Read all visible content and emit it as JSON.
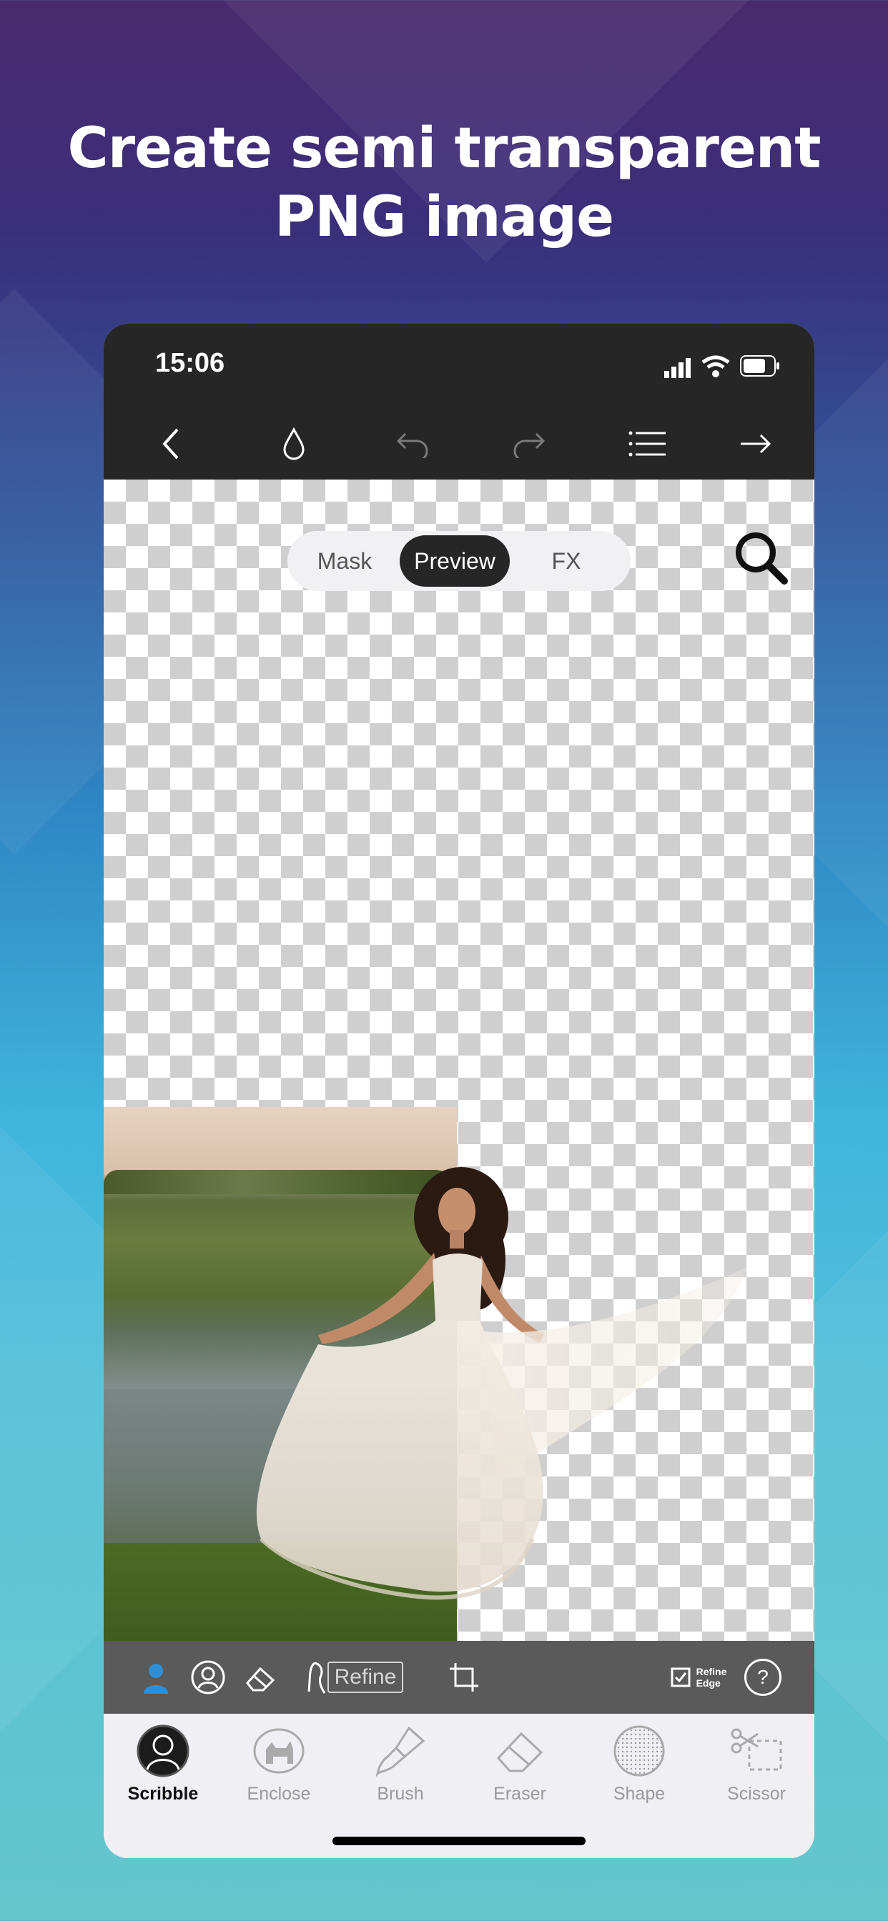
{
  "headline": {
    "line1": "Create semi transparent",
    "line2": "PNG image"
  },
  "status_bar": {
    "time": "15:06",
    "icons": [
      "cellular-signal-icon",
      "wifi-icon",
      "battery-icon"
    ]
  },
  "toolbar": {
    "icons": [
      "back-chevron-icon",
      "drop-icon",
      "undo-icon",
      "redo-icon",
      "menu-list-icon",
      "forward-arrow-icon"
    ]
  },
  "view_toggle": {
    "options": [
      "Mask",
      "Preview",
      "FX"
    ],
    "selected": "Preview"
  },
  "tools_strip": {
    "refine_label": "Refine",
    "refine_edge_line1": "Refine",
    "refine_edge_line2": "Edge",
    "refine_edge_checked": true,
    "help_label": "?"
  },
  "tabs": [
    {
      "label": "Scribble",
      "icon": "scribble-icon",
      "active": true
    },
    {
      "label": "Enclose",
      "icon": "enclose-icon",
      "active": false
    },
    {
      "label": "Brush",
      "icon": "brush-icon",
      "active": false
    },
    {
      "label": "Eraser",
      "icon": "eraser-icon",
      "active": false
    },
    {
      "label": "Shape",
      "icon": "shape-icon",
      "active": false
    },
    {
      "label": "Scissor",
      "icon": "scissor-icon",
      "active": false
    }
  ],
  "colors": {
    "dark_bar": "#262626",
    "tools_strip": "#5a5a5a",
    "accent_blue": "#2e8fd6",
    "tab_background": "#efeff4"
  }
}
